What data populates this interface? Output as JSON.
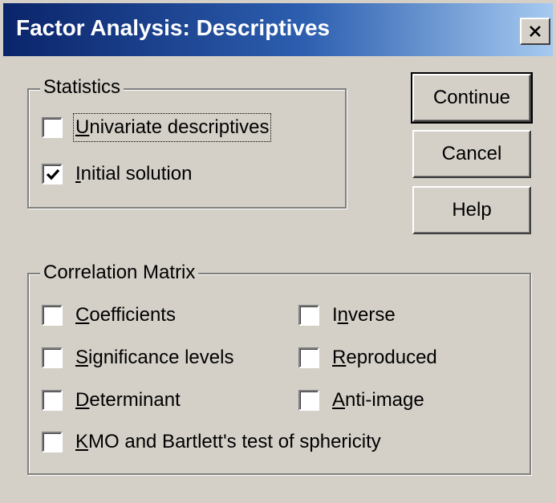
{
  "window": {
    "title": "Factor Analysis: Descriptives"
  },
  "statistics": {
    "legend": "Statistics",
    "items": [
      {
        "mnemonic": "U",
        "rest": "nivariate descriptives",
        "checked": false
      },
      {
        "mnemonic": "I",
        "rest": "nitial solution",
        "checked": true
      }
    ]
  },
  "correlation": {
    "legend": "Correlation Matrix",
    "coefficients": {
      "mnemonic": "C",
      "rest": "oefficients",
      "checked": false
    },
    "significance": {
      "mnemonic": "S",
      "rest": "ignificance levels",
      "checked": false
    },
    "determinant": {
      "mnemonic": "D",
      "rest": "eterminant",
      "checked": false
    },
    "kmo": {
      "mnemonic": "K",
      "rest": "MO and Bartlett's test of sphericity",
      "checked": false
    },
    "inverse": {
      "pre": "I",
      "mnemonic": "n",
      "rest": "verse",
      "checked": false
    },
    "reproduced": {
      "mnemonic": "R",
      "rest": "eproduced",
      "checked": false
    },
    "antiimage": {
      "mnemonic": "A",
      "rest": "nti-image",
      "checked": false
    }
  },
  "buttons": {
    "continue": "Continue",
    "cancel": "Cancel",
    "help": "Help"
  },
  "icons": {
    "close": "close-icon",
    "check": "check-icon"
  }
}
